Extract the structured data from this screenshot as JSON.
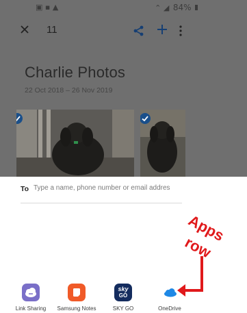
{
  "status_bar": {
    "left_icons": "▣ ▪ ▲",
    "right_icons": "⌃ ◢",
    "battery": "84%"
  },
  "toolbar": {
    "selected_count": "11",
    "close_icon": "close-icon",
    "share_icon": "share-icon",
    "add_icon": "plus-icon",
    "more_icon": "more-vertical-icon"
  },
  "album": {
    "title": "Charlie Photos",
    "dates": "22 Oct 2018 – 26 Nov 2019"
  },
  "share_sheet": {
    "to_label": "To",
    "to_placeholder": "Type a name, phone number or email addres"
  },
  "apps_row": [
    {
      "label": "Link Sharing",
      "color": "#7a6fc8"
    },
    {
      "label": "Samsung Notes",
      "color": "#f05a28"
    },
    {
      "label": "SKY GO",
      "color": "#142c5e",
      "icon_text_top": "sky",
      "icon_text_bottom": "GO"
    },
    {
      "label": "OneDrive",
      "color": "#1e88e5"
    }
  ],
  "annotation": {
    "line1": "Apps",
    "line2": "row",
    "color": "#e0191b"
  }
}
